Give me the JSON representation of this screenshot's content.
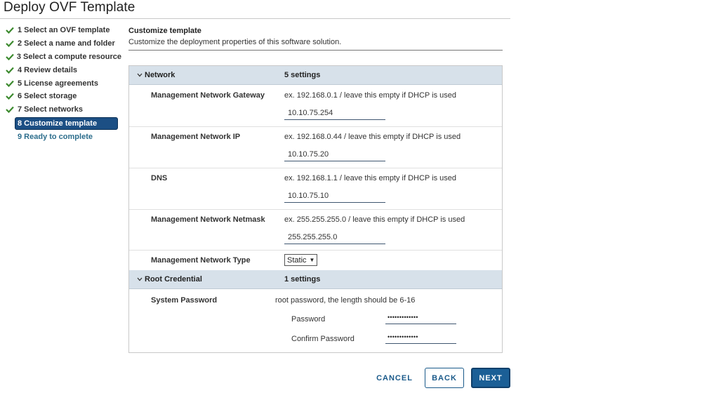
{
  "window": {
    "title": "Deploy OVF Template"
  },
  "steps": [
    {
      "label": "1 Select an OVF template",
      "state": "done"
    },
    {
      "label": "2 Select a name and folder",
      "state": "done"
    },
    {
      "label": "3 Select a compute resource",
      "state": "done"
    },
    {
      "label": "4 Review details",
      "state": "done"
    },
    {
      "label": "5 License agreements",
      "state": "done"
    },
    {
      "label": "6 Select storage",
      "state": "done"
    },
    {
      "label": "7 Select networks",
      "state": "done"
    },
    {
      "label": "8 Customize template",
      "state": "active"
    },
    {
      "label": "9 Ready to complete",
      "state": "future"
    }
  ],
  "content": {
    "title": "Customize template",
    "subtitle": "Customize the deployment properties of this software solution."
  },
  "network": {
    "name": "Network",
    "count": "5 settings",
    "gateway": {
      "label": "Management Network Gateway",
      "hint": "ex. 192.168.0.1 / leave this empty if DHCP is used",
      "value": "10.10.75.254"
    },
    "ip": {
      "label": "Management Network IP",
      "hint": "ex. 192.168.0.44 / leave this empty if DHCP is used",
      "value": "10.10.75.20"
    },
    "dns": {
      "label": "DNS",
      "hint": "ex. 192.168.1.1 / leave this empty if DHCP is used",
      "value": "10.10.75.10"
    },
    "netmask": {
      "label": "Management Network Netmask",
      "hint": "ex. 255.255.255.0 / leave this empty if DHCP is used",
      "value": "255.255.255.0"
    },
    "type": {
      "label": "Management Network Type",
      "value": "Static"
    }
  },
  "root": {
    "name": "Root Credential",
    "count": "1 settings",
    "label": "System Password",
    "hint": "root password, the length should be 6-16",
    "password_label": "Password",
    "password_value": "•••••••••••••",
    "confirm_label": "Confirm Password",
    "confirm_value": "•••••••••••••"
  },
  "buttons": {
    "cancel": "CANCEL",
    "back": "BACK",
    "next": "NEXT"
  },
  "colors": {
    "accent": "#1b5f96",
    "check": "#3c8a2e",
    "section_bg": "#d7e1ea"
  }
}
